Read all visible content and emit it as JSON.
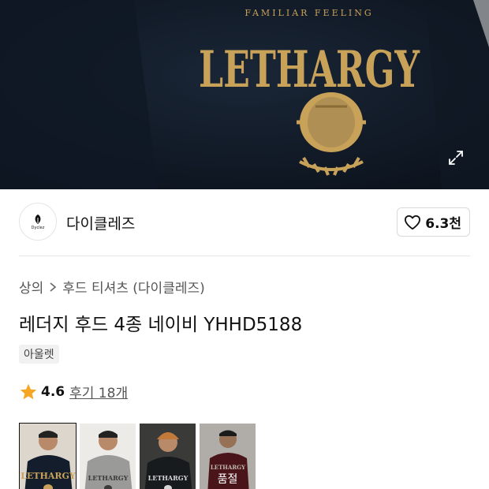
{
  "hero": {
    "print_top": "FAMILIAR FEELING",
    "print_main": "LETHARGY",
    "expand_icon": "expand-icon"
  },
  "brand": {
    "logo_text": "Dyclez",
    "name": "다이클레즈",
    "like_count": "6.3천",
    "like_icon": "heart-icon"
  },
  "breadcrumb": {
    "items": [
      "상의",
      "후드 티셔츠 (다이클레즈)"
    ],
    "separator_icon": "chevron-right-icon"
  },
  "product": {
    "title": "레더지 후드 4종 네이비 YHHD5188",
    "badge": "아울렛",
    "rating": "4.6",
    "rating_icon": "star-icon",
    "review_link": "후기 18개"
  },
  "thumbnails": [
    {
      "color": "navy",
      "status": ""
    },
    {
      "color": "gray",
      "status": ""
    },
    {
      "color": "black",
      "status": ""
    },
    {
      "color": "burgundy",
      "status": "품절"
    }
  ],
  "colors": {
    "star": "#f5a623",
    "hoodie_navy": "#131d2b",
    "print_gold": "#c9a25a"
  }
}
